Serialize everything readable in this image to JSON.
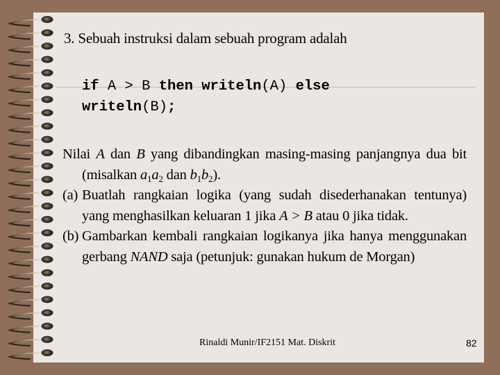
{
  "slide": {
    "background_color": "#8f6e5a",
    "paper_color": "#ebe6e2",
    "ring_count": 26
  },
  "title": "3. Sebuah instruksi dalam sebuah program adalah",
  "code": {
    "line1": [
      {
        "text": "if",
        "bold": true
      },
      {
        "text": " A > B ",
        "bold": false
      },
      {
        "text": "then writeln",
        "bold": true
      },
      {
        "text": "(A) ",
        "bold": false
      },
      {
        "text": "else",
        "bold": true
      }
    ],
    "line2": [
      {
        "text": "writeln",
        "bold": true
      },
      {
        "text": "(B)",
        "bold": false
      },
      {
        "text": ";",
        "bold": true
      }
    ]
  },
  "intro": {
    "p1": "Nilai ",
    "var_a": "A",
    "p2": " dan ",
    "var_b": "B",
    "p3": " yang dibandingkan masing-masing panjangnya dua bit (misalkan ",
    "a": "a",
    "a_sub1": "1",
    "a2": "a",
    "a_sub2": "2",
    "p4": " dan ",
    "b": "b",
    "b_sub1": "1",
    "b2": "b",
    "b_sub2": "2",
    "p5": ")."
  },
  "item_a": {
    "label": "(a)",
    "t1": "Buatlah rangkaian logika (yang sudah disederhanakan tentunya)  yang menghasilkan keluaran 1 jika ",
    "expr": "A > B",
    "t2": " atau 0 jika tidak."
  },
  "item_b": {
    "label": "(b)",
    "t1": "Gambarkan kembali rangkaian logikanya jika hanya menggunakan gerbang ",
    "nand": "NAND",
    "t2": " saja (petunjuk: gunakan hukum de Morgan)"
  },
  "footer": {
    "text": "Rinaldi Munir/IF2151 Mat. Diskrit",
    "page_number": "82"
  }
}
